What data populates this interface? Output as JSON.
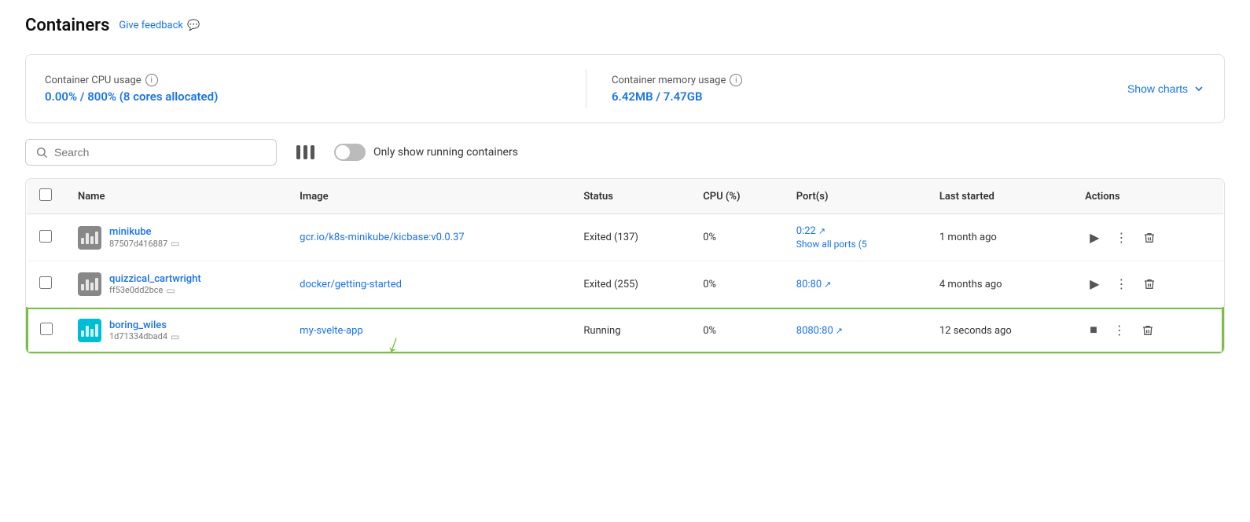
{
  "header": {
    "title": "Containers",
    "feedback_label": "Give feedback",
    "feedback_icon": "💬"
  },
  "stats": {
    "cpu_label": "Container CPU usage",
    "cpu_value": "0.00% / 800% (8 cores allocated)",
    "memory_label": "Container memory usage",
    "memory_value": "6.42MB / 7.47GB",
    "show_charts_label": "Show charts"
  },
  "toolbar": {
    "search_placeholder": "Search",
    "toggle_label": "Only show running containers"
  },
  "table": {
    "columns": [
      "",
      "Name",
      "Image",
      "Status",
      "CPU (%)",
      "Port(s)",
      "Last started",
      "Actions"
    ],
    "rows": [
      {
        "id": "row-minikube",
        "name": "minikube",
        "container_id": "87507d416887",
        "image": "gcr.io/k8s-minikube/kicbase:v0.0.37",
        "status": "Exited (137)",
        "cpu": "0%",
        "port": "0:22",
        "port_link": "0:22",
        "show_all_ports": "Show all ports (5",
        "last_started": "1 month ago",
        "highlighted": false,
        "running": false,
        "icon_color": "gray"
      },
      {
        "id": "row-quizzical",
        "name": "quizzical_cartwright",
        "container_id": "ff53e0dd2bce",
        "image": "docker/getting-started",
        "status": "Exited (255)",
        "cpu": "0%",
        "port": "80:80",
        "port_link": "80:80",
        "show_all_ports": "",
        "last_started": "4 months ago",
        "highlighted": false,
        "running": false,
        "icon_color": "gray"
      },
      {
        "id": "row-boring-wiles",
        "name": "boring_wiles",
        "container_id": "1d71334dbad4",
        "image": "my-svelte-app",
        "status": "Running",
        "cpu": "0%",
        "port": "8080:80",
        "port_link": "8080:80",
        "show_all_ports": "",
        "last_started": "12 seconds ago",
        "highlighted": true,
        "running": true,
        "icon_color": "teal"
      }
    ]
  }
}
